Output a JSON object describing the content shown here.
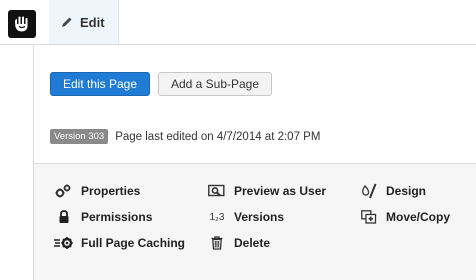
{
  "toolbar": {
    "edit_tab_label": "Edit",
    "logo_icon": "concrete5-hand-icon",
    "edit_icon": "pencil-icon"
  },
  "panel": {
    "edit_page_button": "Edit this Page",
    "add_subpage_button": "Add a Sub-Page",
    "version_badge": "Version 303",
    "last_edited_text": "Page last edited on 4/7/2014 at 2:07 PM"
  },
  "actions": {
    "properties": "Properties",
    "permissions": "Permissions",
    "full_page_caching": "Full Page Caching",
    "preview_as_user": "Preview as User",
    "versions": "Versions",
    "versions_glyph": "1₂3",
    "delete": "Delete",
    "design": "Design",
    "move_copy": "Move/Copy"
  },
  "colors": {
    "primary_button": "#1f7bd3",
    "edit_tab_bg": "#eef6fb",
    "badge_bg": "#8a8a8a"
  }
}
